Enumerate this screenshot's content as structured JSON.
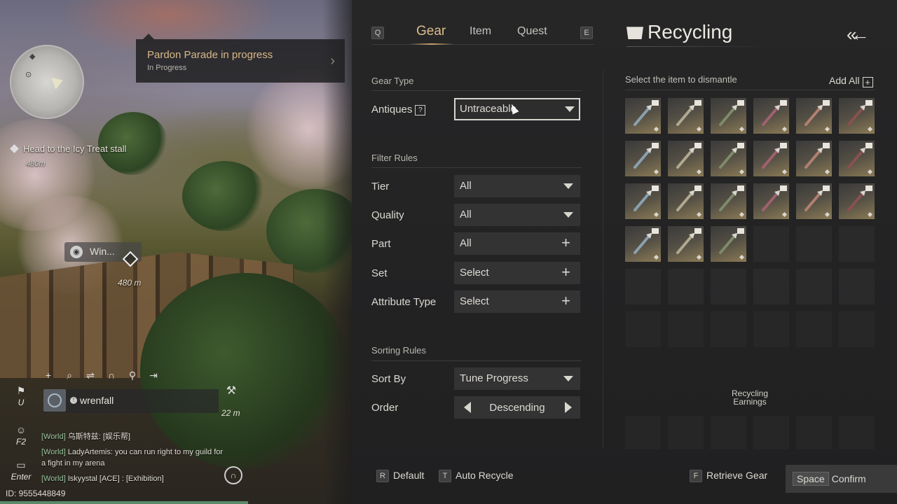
{
  "hud": {
    "quest_banner": {
      "title": "Pardon Parade in progress",
      "status": "In Progress"
    },
    "nav_hint": {
      "text": "Head to the Icy Treat stall",
      "distance": "480m"
    },
    "waypoint": {
      "label": "Win...",
      "distance": "480 m"
    },
    "anvil_distance": "22 m",
    "chat": {
      "username": "wrenfall",
      "lines": [
        {
          "channel": "[World]",
          "text": "乌斯特兹: [娱乐帮]"
        },
        {
          "channel": "[World]",
          "text": "LadyArtemis: you can run right to my guild for a fight in my arena"
        },
        {
          "channel": "[World]",
          "text": "Iskyystal [ACE] : [Exhibition]"
        }
      ]
    },
    "side_keys": [
      {
        "key": "U",
        "icon": "flag-icon"
      },
      {
        "key": "F2",
        "icon": "emote-icon"
      },
      {
        "key": "Enter",
        "icon": "chat-icon"
      }
    ],
    "player_id": "ID: 9555448849"
  },
  "tabs": {
    "left_key": "Q",
    "right_key": "E",
    "items": [
      {
        "label": "Gear",
        "active": true
      },
      {
        "label": "Item",
        "active": false
      },
      {
        "label": "Quest",
        "active": false
      }
    ]
  },
  "filters": {
    "gear_type_title": "Gear Type",
    "antiques": {
      "label": "Antiques",
      "help": "?",
      "value": "Untraceable"
    },
    "filter_rules_title": "Filter Rules",
    "tier": {
      "label": "Tier",
      "value": "All"
    },
    "quality": {
      "label": "Quality",
      "value": "All"
    },
    "part": {
      "label": "Part",
      "value": "All"
    },
    "set": {
      "label": "Set",
      "value": "Select"
    },
    "attribute_type": {
      "label": "Attribute Type",
      "value": "Select"
    },
    "sorting_rules_title": "Sorting Rules",
    "sort_by": {
      "label": "Sort By",
      "value": "Tune Progress"
    },
    "order": {
      "label": "Order",
      "value": "Descending"
    }
  },
  "recycling": {
    "title": "Recycling",
    "header": "Select the item to dismantle",
    "add_all": "Add All",
    "earnings_label_1": "Recycling",
    "earnings_label_2": "Earnings",
    "items": [
      "crossbow-icon",
      "staff-icon",
      "gauntlet-icon",
      "spear-icon",
      "blade-icon",
      "helmet-icon",
      "bracers-icon",
      "polearm-icon",
      "spear-icon",
      "polearm-icon",
      "spear-icon",
      "spear-icon",
      "staff-icon",
      "gauntlet-icon",
      "gauntlet-icon",
      "bracer-icon",
      "blade-icon",
      "helmet-icon",
      "bracer-icon",
      "bracer-icon",
      "spear-icon"
    ]
  },
  "footer": {
    "default": {
      "key": "R",
      "label": "Default"
    },
    "auto_recycle": {
      "key": "T",
      "label": "Auto Recycle"
    },
    "retrieve": {
      "key": "F",
      "label": "Retrieve Gear"
    },
    "confirm": {
      "key": "Space",
      "label": "Confirm"
    }
  }
}
